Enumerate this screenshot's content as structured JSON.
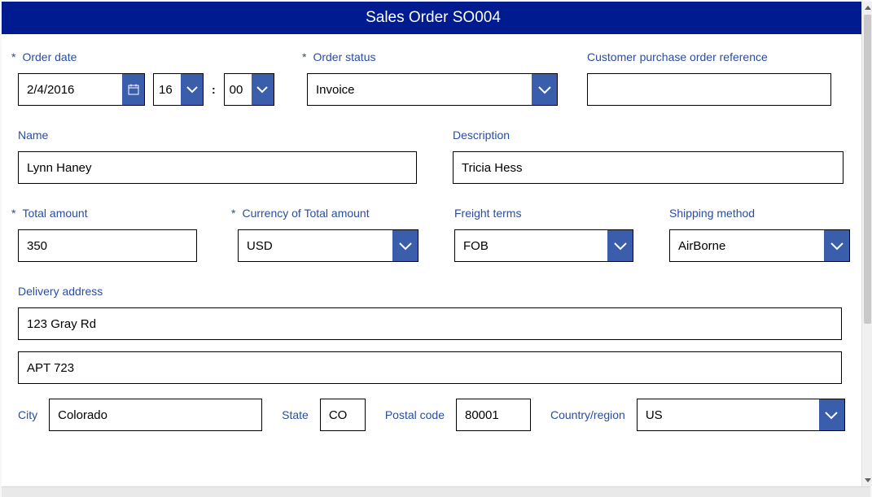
{
  "title": "Sales Order SO004",
  "labels": {
    "order_date": "Order date",
    "order_status": "Order status",
    "customer_po": "Customer purchase order reference",
    "name": "Name",
    "description": "Description",
    "total_amount": "Total amount",
    "currency": "Currency of Total amount",
    "freight_terms": "Freight terms",
    "shipping_method": "Shipping method",
    "delivery_address": "Delivery address",
    "city": "City",
    "state": "State",
    "postal_code": "Postal code",
    "country": "Country/region"
  },
  "values": {
    "order_date": "2/4/2016",
    "hour": "16",
    "minute": "00",
    "order_status": "Invoice",
    "customer_po": "",
    "name": "Lynn Haney",
    "description": "Tricia Hess",
    "total_amount": "350",
    "currency": "USD",
    "freight_terms": "FOB",
    "shipping_method": "AirBorne",
    "address1": "123 Gray Rd",
    "address2": "APT 723",
    "city": "Colorado",
    "state": "CO",
    "postal_code": "80001",
    "country": "US"
  },
  "colors": {
    "accent": "#3a5eac",
    "header": "#001b8f",
    "label": "#2a4da0"
  }
}
